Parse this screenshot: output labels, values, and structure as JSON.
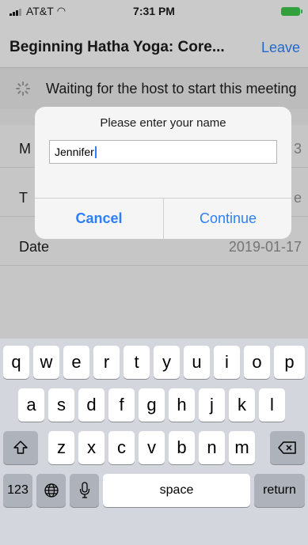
{
  "status_bar": {
    "carrier": "AT&T",
    "time": "7:31 PM"
  },
  "nav": {
    "title": "Beginning Hatha Yoga: Core...",
    "leave_label": "Leave"
  },
  "waiting_banner": {
    "text": "Waiting for the host to start this meeting"
  },
  "meeting_info": {
    "rows": [
      {
        "label": "M",
        "value": "3"
      },
      {
        "label": "T",
        "value": "e"
      },
      {
        "label": "Date",
        "value": "2019-01-17"
      }
    ]
  },
  "name_dialog": {
    "title": "Please enter your name",
    "input_value": "Jennifer",
    "cancel_label": "Cancel",
    "continue_label": "Continue"
  },
  "keyboard": {
    "row1": [
      "q",
      "w",
      "e",
      "r",
      "t",
      "y",
      "u",
      "i",
      "o",
      "p"
    ],
    "row2": [
      "a",
      "s",
      "d",
      "f",
      "g",
      "h",
      "j",
      "k",
      "l"
    ],
    "row3": [
      "z",
      "x",
      "c",
      "v",
      "b",
      "n",
      "m"
    ],
    "numbers_label": "123",
    "space_label": "space",
    "return_label": "return",
    "shift_icon": "shift-icon",
    "delete_icon": "delete-icon",
    "globe_icon": "globe-icon",
    "mic_icon": "microphone-icon"
  }
}
